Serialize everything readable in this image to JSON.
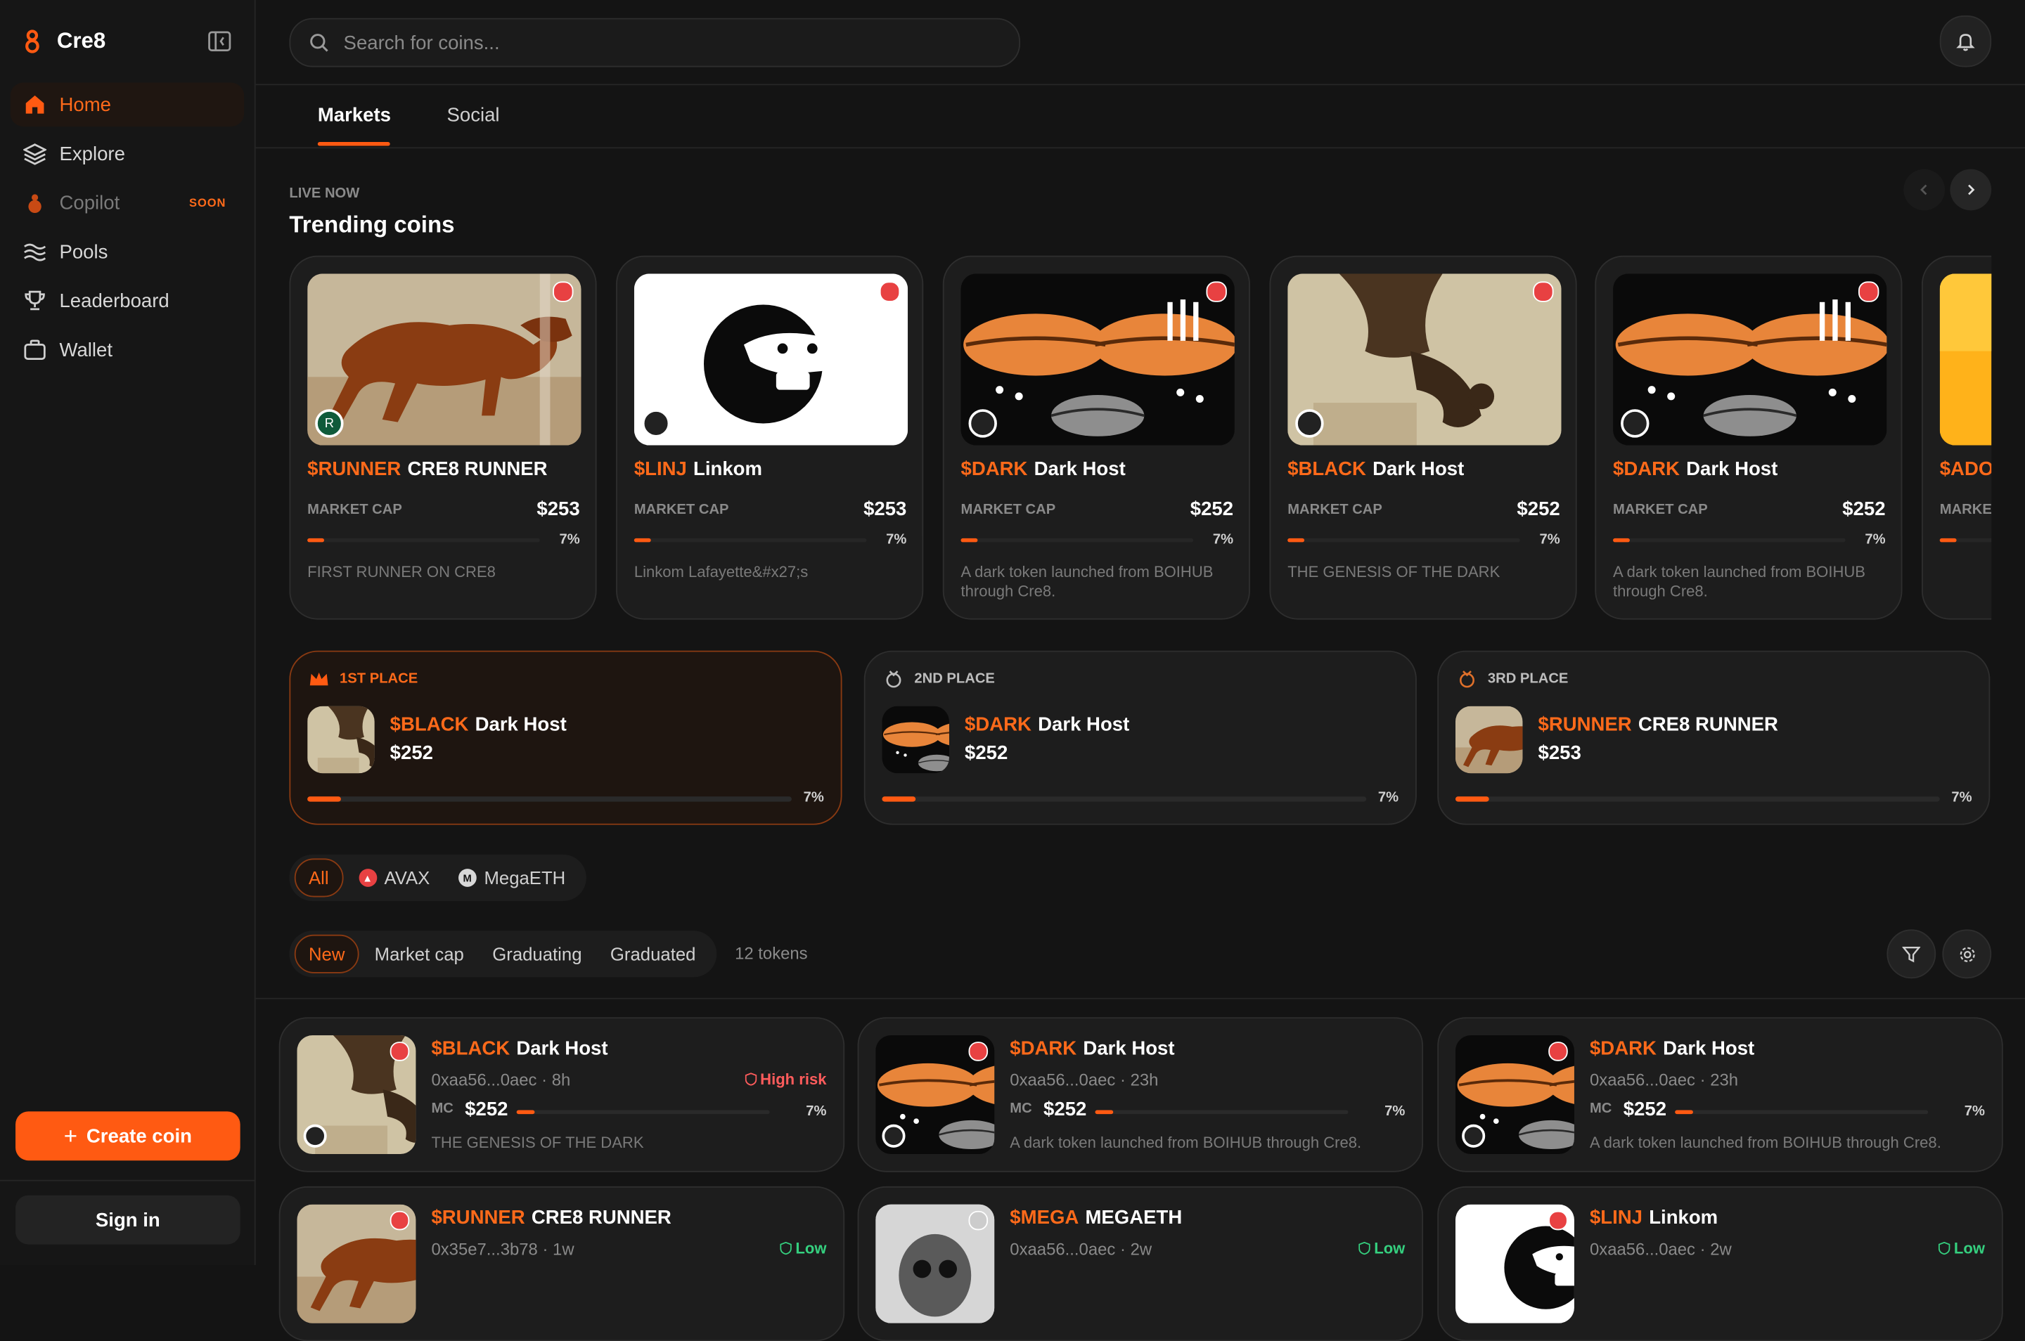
{
  "app": {
    "name": "Cre8"
  },
  "colors": {
    "accent": "#ff5a12",
    "avax": "#e84142",
    "low_risk": "#35d07f",
    "high_risk": "#ff5c5c"
  },
  "sidebar": {
    "items": [
      {
        "label": "Home",
        "icon": "home-icon"
      },
      {
        "label": "Explore",
        "icon": "layers-icon"
      },
      {
        "label": "Copilot",
        "icon": "copilot-icon",
        "badge": "SOON"
      },
      {
        "label": "Pools",
        "icon": "waves-icon"
      },
      {
        "label": "Leaderboard",
        "icon": "trophy-icon"
      },
      {
        "label": "Wallet",
        "icon": "wallet-icon"
      }
    ],
    "create_label": "Create coin",
    "signin_label": "Sign in"
  },
  "search": {
    "placeholder": "Search for coins..."
  },
  "tabs": [
    {
      "label": "Markets"
    },
    {
      "label": "Social"
    }
  ],
  "trending": {
    "eyebrow": "LIVE NOW",
    "title": "Trending coins",
    "mc_label": "MARKET CAP",
    "cards": [
      {
        "ticker": "$RUNNER",
        "name": "CRE8 RUNNER",
        "market_cap": "$253",
        "progress": "7%",
        "description": "FIRST RUNNER ON CRE8",
        "avatar": "R"
      },
      {
        "ticker": "$LINJ",
        "name": "Linkom",
        "market_cap": "$253",
        "progress": "7%",
        "description": "Linkom Lafayette&#x27;s",
        "avatar": ""
      },
      {
        "ticker": "$DARK",
        "name": "Dark Host",
        "market_cap": "$252",
        "progress": "7%",
        "description": "A dark token launched from BOIHUB through Cre8.",
        "avatar": ""
      },
      {
        "ticker": "$BLACK",
        "name": "Dark Host",
        "market_cap": "$252",
        "progress": "7%",
        "description": "THE GENESIS OF THE DARK",
        "avatar": ""
      },
      {
        "ticker": "$DARK",
        "name": "Dark Host",
        "market_cap": "$252",
        "progress": "7%",
        "description": "A dark token launched from BOIHUB through Cre8.",
        "avatar": ""
      },
      {
        "ticker": "$ADO",
        "name": "",
        "market_cap": "",
        "progress": "",
        "description": "",
        "avatar": ""
      }
    ]
  },
  "leaders": [
    {
      "place": "1ST PLACE",
      "ticker": "$BLACK",
      "name": "Dark Host",
      "market_cap": "$252",
      "progress": "7%"
    },
    {
      "place": "2ND PLACE",
      "ticker": "$DARK",
      "name": "Dark Host",
      "market_cap": "$252",
      "progress": "7%"
    },
    {
      "place": "3RD PLACE",
      "ticker": "$RUNNER",
      "name": "CRE8 RUNNER",
      "market_cap": "$253",
      "progress": "7%"
    }
  ],
  "chain_filters": [
    {
      "label": "All"
    },
    {
      "label": "AVAX"
    },
    {
      "label": "MegaETH"
    }
  ],
  "sort_filters": [
    {
      "label": "New"
    },
    {
      "label": "Market cap"
    },
    {
      "label": "Graduating"
    },
    {
      "label": "Graduated"
    }
  ],
  "token_count": "12 tokens",
  "tokens": {
    "mc_label": "MC",
    "items": [
      {
        "ticker": "$BLACK",
        "name": "Dark Host",
        "address": "0xaa56...0aec",
        "age": "8h",
        "risk": "High risk",
        "market_cap": "$252",
        "progress": "7%",
        "description": "THE GENESIS OF THE DARK"
      },
      {
        "ticker": "$DARK",
        "name": "Dark Host",
        "address": "0xaa56...0aec",
        "age": "23h",
        "risk": "",
        "market_cap": "$252",
        "progress": "7%",
        "description": "A dark token launched from BOIHUB through Cre8."
      },
      {
        "ticker": "$DARK",
        "name": "Dark Host",
        "address": "0xaa56...0aec",
        "age": "23h",
        "risk": "",
        "market_cap": "$252",
        "progress": "7%",
        "description": "A dark token launched from BOIHUB through Cre8."
      },
      {
        "ticker": "$RUNNER",
        "name": "CRE8 RUNNER",
        "address": "0x35e7...3b78",
        "age": "1w",
        "risk": "Low",
        "market_cap": "",
        "progress": "",
        "description": ""
      },
      {
        "ticker": "$MEGA",
        "name": "MEGAETH",
        "address": "0xaa56...0aec",
        "age": "2w",
        "risk": "Low",
        "market_cap": "",
        "progress": "",
        "description": ""
      },
      {
        "ticker": "$LINJ",
        "name": "Linkom",
        "address": "0xaa56...0aec",
        "age": "2w",
        "risk": "Low",
        "market_cap": "",
        "progress": "",
        "description": ""
      }
    ]
  }
}
